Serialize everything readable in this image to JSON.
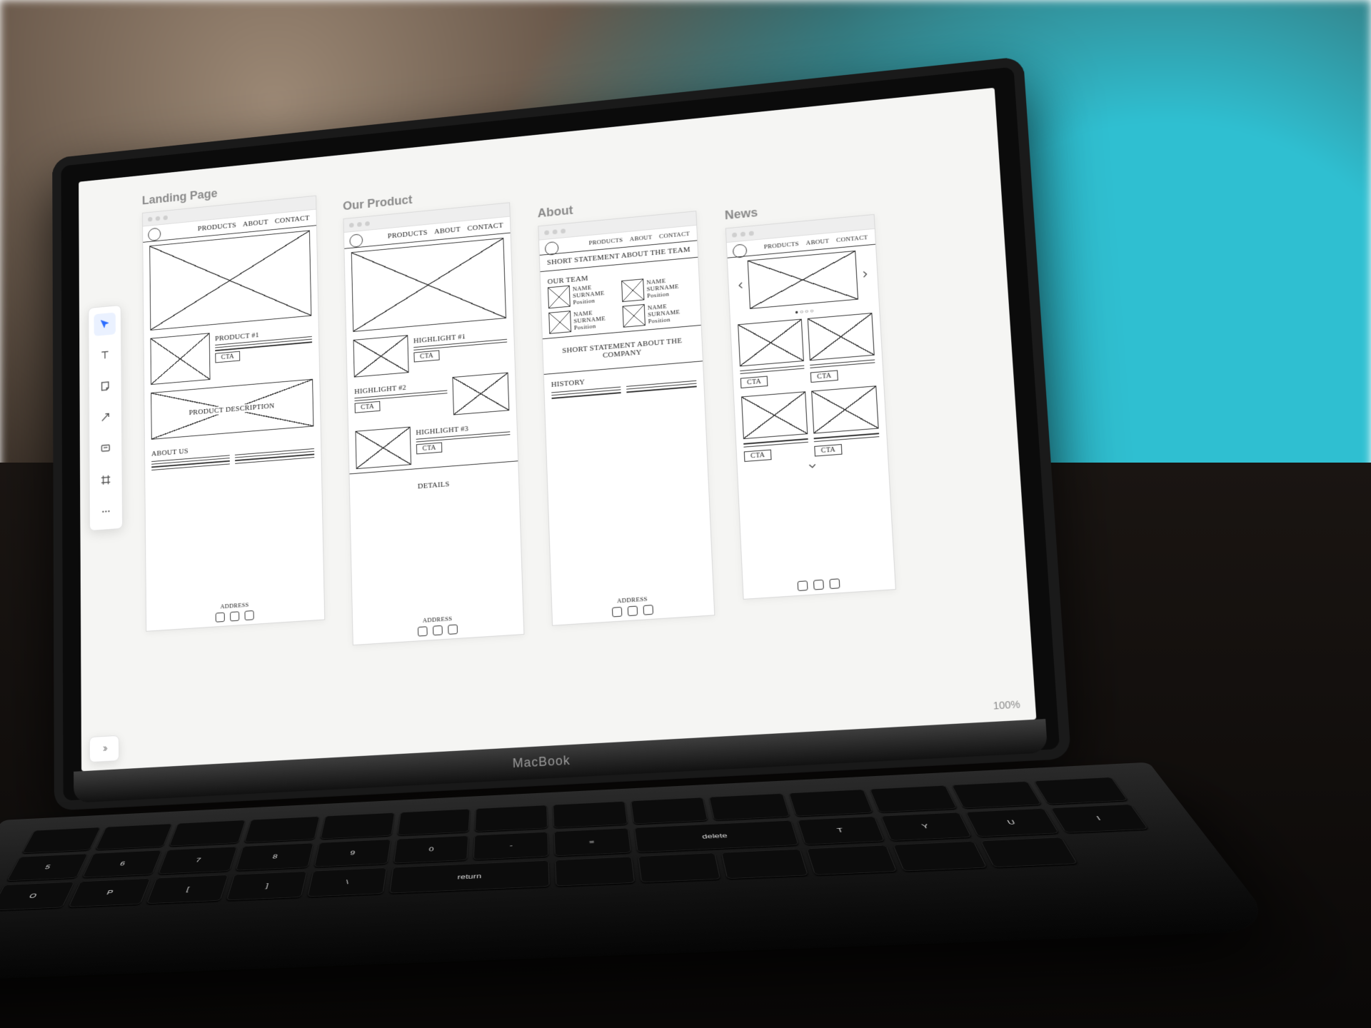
{
  "hardware": {
    "brand": "MacBook"
  },
  "app": {
    "zoom": "100%"
  },
  "toolbar": {
    "items": [
      "cursor-icon",
      "text-icon",
      "note-icon",
      "arrow-icon",
      "comment-icon",
      "frame-icon",
      "more-icon"
    ]
  },
  "nav": {
    "products": "PRODUCTS",
    "about": "ABOUT",
    "contact": "CONTACT"
  },
  "footer": {
    "address": "ADDRESS"
  },
  "cta": "CTA",
  "artboards": {
    "landing": {
      "title": "Landing Page",
      "product1": "PRODUCT #1",
      "product_description": "PRODUCT DESCRIPTION",
      "about_us": "ABOUT US"
    },
    "product": {
      "title": "Our Product",
      "h1": "HIGHLIGHT #1",
      "h2": "HIGHLIGHT #2",
      "h3": "HIGHLIGHT #3",
      "details": "DETAILS"
    },
    "about": {
      "title": "About",
      "statement_team": "SHORT STATEMENT ABOUT THE TEAM",
      "our_team": "OUR TEAM",
      "member_name": "NAME SURNAME",
      "member_role": "Position",
      "statement_company": "SHORT STATEMENT ABOUT THE COMPANY",
      "history": "HISTORY"
    },
    "news": {
      "title": "News"
    }
  }
}
